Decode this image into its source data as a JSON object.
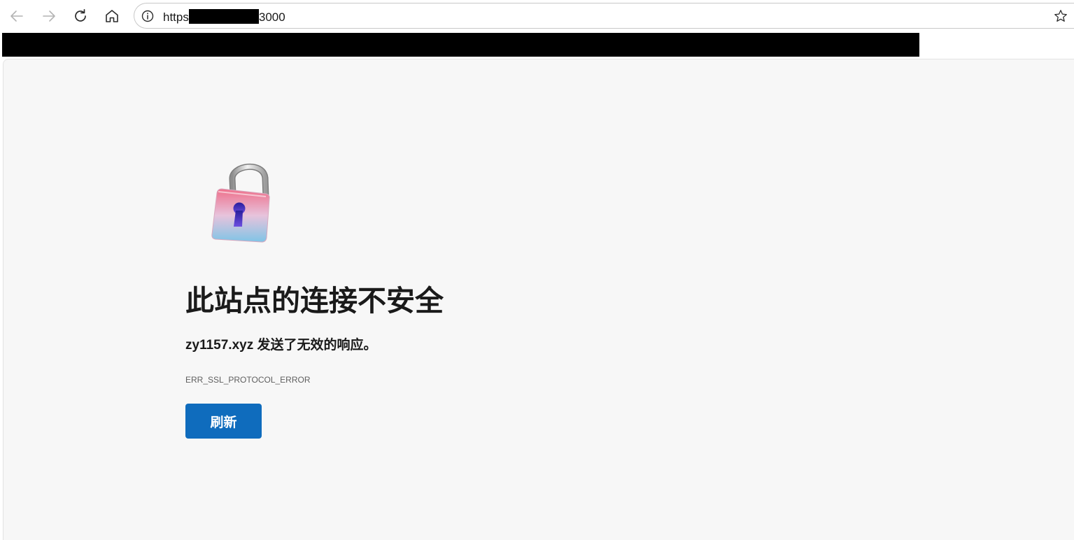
{
  "browser": {
    "url": {
      "prefix": "https",
      "suffix": "3000"
    },
    "icons": {
      "back": "arrow-left-icon",
      "forward": "arrow-right-icon",
      "reload": "reload-icon",
      "home": "home-icon",
      "site_info": "info-icon",
      "favorite": "star-icon"
    }
  },
  "error_page": {
    "icon": "unlocked-padlock-icon",
    "title": "此站点的连接不安全",
    "message": "zy1157.xyz 发送了无效的响应。",
    "error_code": "ERR_SSL_PROTOCOL_ERROR",
    "reload_label": "刷新"
  },
  "colors": {
    "primary_button": "#0f6cbd",
    "page_background": "#f7f7f7"
  }
}
